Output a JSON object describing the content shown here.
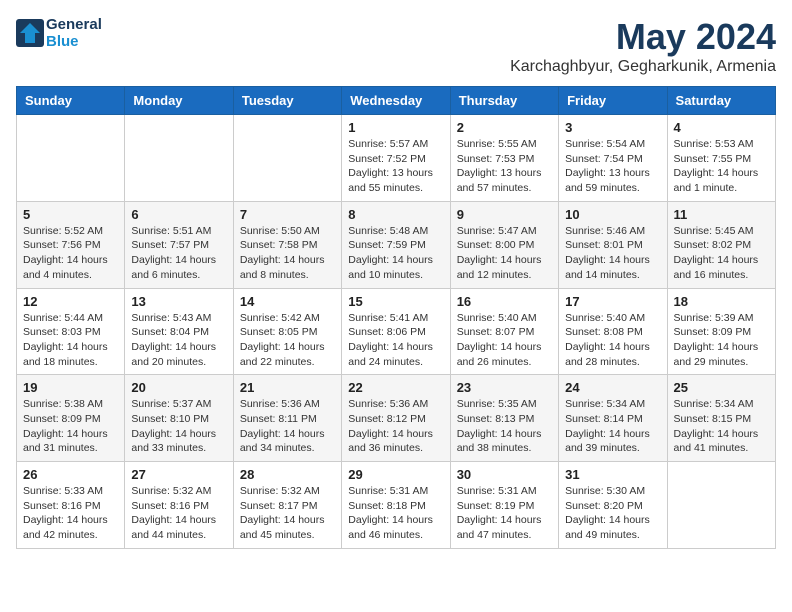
{
  "header": {
    "logo_line1": "General",
    "logo_line2": "Blue",
    "month": "May 2024",
    "location": "Karchaghbyur, Gegharkunik, Armenia"
  },
  "weekdays": [
    "Sunday",
    "Monday",
    "Tuesday",
    "Wednesday",
    "Thursday",
    "Friday",
    "Saturday"
  ],
  "weeks": [
    [
      {
        "day": "",
        "info": ""
      },
      {
        "day": "",
        "info": ""
      },
      {
        "day": "",
        "info": ""
      },
      {
        "day": "1",
        "info": "Sunrise: 5:57 AM\nSunset: 7:52 PM\nDaylight: 13 hours\nand 55 minutes."
      },
      {
        "day": "2",
        "info": "Sunrise: 5:55 AM\nSunset: 7:53 PM\nDaylight: 13 hours\nand 57 minutes."
      },
      {
        "day": "3",
        "info": "Sunrise: 5:54 AM\nSunset: 7:54 PM\nDaylight: 13 hours\nand 59 minutes."
      },
      {
        "day": "4",
        "info": "Sunrise: 5:53 AM\nSunset: 7:55 PM\nDaylight: 14 hours\nand 1 minute."
      }
    ],
    [
      {
        "day": "5",
        "info": "Sunrise: 5:52 AM\nSunset: 7:56 PM\nDaylight: 14 hours\nand 4 minutes."
      },
      {
        "day": "6",
        "info": "Sunrise: 5:51 AM\nSunset: 7:57 PM\nDaylight: 14 hours\nand 6 minutes."
      },
      {
        "day": "7",
        "info": "Sunrise: 5:50 AM\nSunset: 7:58 PM\nDaylight: 14 hours\nand 8 minutes."
      },
      {
        "day": "8",
        "info": "Sunrise: 5:48 AM\nSunset: 7:59 PM\nDaylight: 14 hours\nand 10 minutes."
      },
      {
        "day": "9",
        "info": "Sunrise: 5:47 AM\nSunset: 8:00 PM\nDaylight: 14 hours\nand 12 minutes."
      },
      {
        "day": "10",
        "info": "Sunrise: 5:46 AM\nSunset: 8:01 PM\nDaylight: 14 hours\nand 14 minutes."
      },
      {
        "day": "11",
        "info": "Sunrise: 5:45 AM\nSunset: 8:02 PM\nDaylight: 14 hours\nand 16 minutes."
      }
    ],
    [
      {
        "day": "12",
        "info": "Sunrise: 5:44 AM\nSunset: 8:03 PM\nDaylight: 14 hours\nand 18 minutes."
      },
      {
        "day": "13",
        "info": "Sunrise: 5:43 AM\nSunset: 8:04 PM\nDaylight: 14 hours\nand 20 minutes."
      },
      {
        "day": "14",
        "info": "Sunrise: 5:42 AM\nSunset: 8:05 PM\nDaylight: 14 hours\nand 22 minutes."
      },
      {
        "day": "15",
        "info": "Sunrise: 5:41 AM\nSunset: 8:06 PM\nDaylight: 14 hours\nand 24 minutes."
      },
      {
        "day": "16",
        "info": "Sunrise: 5:40 AM\nSunset: 8:07 PM\nDaylight: 14 hours\nand 26 minutes."
      },
      {
        "day": "17",
        "info": "Sunrise: 5:40 AM\nSunset: 8:08 PM\nDaylight: 14 hours\nand 28 minutes."
      },
      {
        "day": "18",
        "info": "Sunrise: 5:39 AM\nSunset: 8:09 PM\nDaylight: 14 hours\nand 29 minutes."
      }
    ],
    [
      {
        "day": "19",
        "info": "Sunrise: 5:38 AM\nSunset: 8:09 PM\nDaylight: 14 hours\nand 31 minutes."
      },
      {
        "day": "20",
        "info": "Sunrise: 5:37 AM\nSunset: 8:10 PM\nDaylight: 14 hours\nand 33 minutes."
      },
      {
        "day": "21",
        "info": "Sunrise: 5:36 AM\nSunset: 8:11 PM\nDaylight: 14 hours\nand 34 minutes."
      },
      {
        "day": "22",
        "info": "Sunrise: 5:36 AM\nSunset: 8:12 PM\nDaylight: 14 hours\nand 36 minutes."
      },
      {
        "day": "23",
        "info": "Sunrise: 5:35 AM\nSunset: 8:13 PM\nDaylight: 14 hours\nand 38 minutes."
      },
      {
        "day": "24",
        "info": "Sunrise: 5:34 AM\nSunset: 8:14 PM\nDaylight: 14 hours\nand 39 minutes."
      },
      {
        "day": "25",
        "info": "Sunrise: 5:34 AM\nSunset: 8:15 PM\nDaylight: 14 hours\nand 41 minutes."
      }
    ],
    [
      {
        "day": "26",
        "info": "Sunrise: 5:33 AM\nSunset: 8:16 PM\nDaylight: 14 hours\nand 42 minutes."
      },
      {
        "day": "27",
        "info": "Sunrise: 5:32 AM\nSunset: 8:16 PM\nDaylight: 14 hours\nand 44 minutes."
      },
      {
        "day": "28",
        "info": "Sunrise: 5:32 AM\nSunset: 8:17 PM\nDaylight: 14 hours\nand 45 minutes."
      },
      {
        "day": "29",
        "info": "Sunrise: 5:31 AM\nSunset: 8:18 PM\nDaylight: 14 hours\nand 46 minutes."
      },
      {
        "day": "30",
        "info": "Sunrise: 5:31 AM\nSunset: 8:19 PM\nDaylight: 14 hours\nand 47 minutes."
      },
      {
        "day": "31",
        "info": "Sunrise: 5:30 AM\nSunset: 8:20 PM\nDaylight: 14 hours\nand 49 minutes."
      },
      {
        "day": "",
        "info": ""
      }
    ]
  ]
}
